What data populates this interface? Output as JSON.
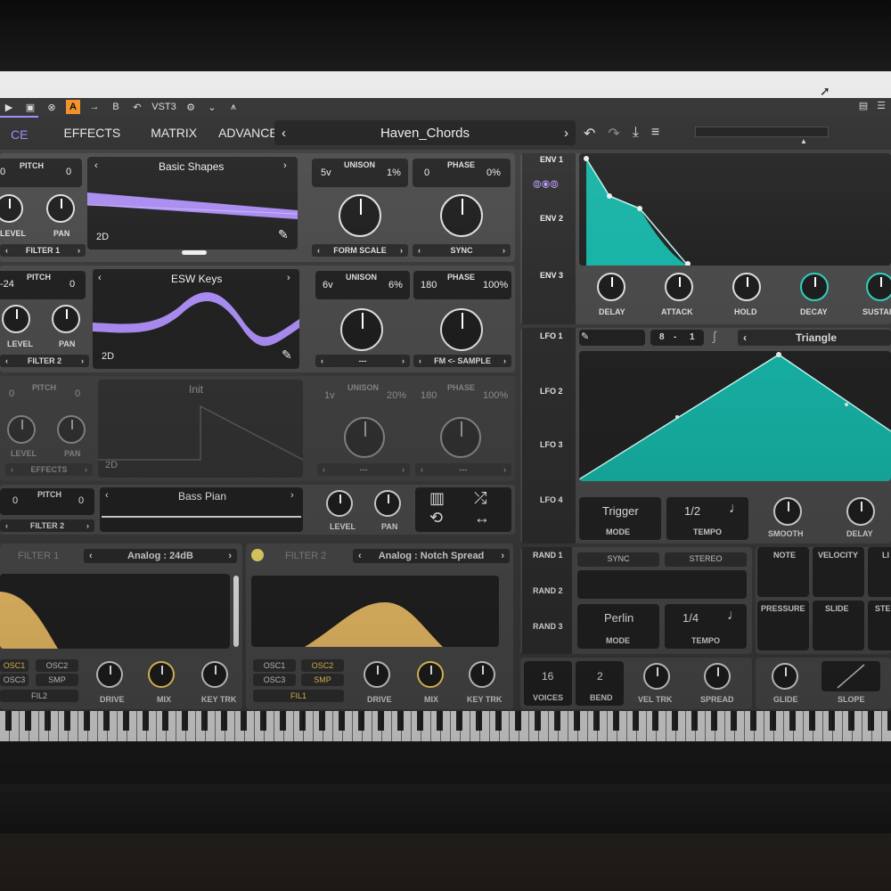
{
  "toolbar": {
    "icons": [
      "play-icon",
      "save-icon",
      "bypass-icon",
      "a-b-compare-icon",
      "arrow-right-icon",
      "b-compare-icon",
      "undo-icon",
      "settings-icon",
      "spectrum-icon"
    ],
    "a_label": "A",
    "b_label": "B",
    "format": "VST3"
  },
  "header": {
    "tabs": [
      {
        "label": "CE",
        "selected": true
      },
      {
        "label": "EFFECTS"
      },
      {
        "label": "MATRIX"
      },
      {
        "label": "ADVANCED"
      }
    ],
    "preset_name": "Haven_Chords",
    "prev_arrow": "‹",
    "next_arrow": "›"
  },
  "osc1": {
    "pitch_label": "PITCH",
    "pitch_left": "0",
    "pitch_right": "0",
    "level_label": "LEVEL",
    "pan_label": "PAN",
    "route": "FILTER 1",
    "wavetable": "Basic Shapes",
    "mode": "2D",
    "unison_label": "UNISON",
    "unison_voices": "5v",
    "unison_detune": "1%",
    "phase_label": "PHASE",
    "phase_value": "0",
    "phase_rand": "0%",
    "form_scale": "FORM SCALE",
    "sync": "SYNC"
  },
  "osc2": {
    "pitch_label": "PITCH",
    "pitch_left": "-24",
    "pitch_right": "0",
    "level_label": "LEVEL",
    "pan_label": "PAN",
    "route": "FILTER 2",
    "wavetable": "ESW Keys",
    "mode": "2D",
    "unison_label": "UNISON",
    "unison_voices": "6v",
    "unison_detune": "6%",
    "phase_label": "PHASE",
    "phase_value": "180",
    "phase_rand": "100%",
    "spectral": "---",
    "fm": "FM <- SAMPLE"
  },
  "osc3": {
    "pitch_label": "PITCH",
    "pitch_left": "0",
    "pitch_right": "0",
    "level_label": "LEVEL",
    "pan_label": "PAN",
    "route": "EFFECTS",
    "wavetable": "Init",
    "mode": "2D",
    "unison_label": "UNISON",
    "unison_voices": "1v",
    "unison_detune": "20%",
    "phase_label": "PHASE",
    "phase_value": "180",
    "phase_rand": "100%",
    "spectral": "---",
    "fm": "---"
  },
  "sample": {
    "pitch_label": "PITCH",
    "pitch_left": "0",
    "pitch_right": "0",
    "route": "FILTER 2",
    "name": "Bass Pian",
    "level_label": "LEVEL",
    "pan_label": "PAN"
  },
  "filter1": {
    "title": "FILTER 1",
    "model": "Analog : 24dB",
    "srcs": [
      "OSC1",
      "OSC2",
      "OSC3",
      "SMP"
    ],
    "route": "FIL2",
    "drive": "DRIVE",
    "mix": "MIX",
    "key_trk": "KEY TRK"
  },
  "filter2": {
    "title": "FILTER 2",
    "model": "Analog : Notch Spread",
    "srcs": [
      "OSC1",
      "OSC2",
      "OSC3",
      "SMP"
    ],
    "route": "FIL1",
    "drive": "DRIVE",
    "mix": "MIX",
    "key_trk": "KEY TRK"
  },
  "env": {
    "tabs": [
      "ENV 1",
      "ENV 2",
      "ENV 3"
    ],
    "knobs": [
      "DELAY",
      "ATTACK",
      "HOLD",
      "DECAY",
      "SUSTAI"
    ]
  },
  "lfo": {
    "tabs": [
      "LFO 1",
      "LFO 2",
      "LFO 3",
      "LFO 4"
    ],
    "grid": "8",
    "grid_sep": "-",
    "smooth_count": "1",
    "shape": "Triangle",
    "mode_value": "Trigger",
    "mode_label": "MODE",
    "tempo_value": "1/2",
    "tempo_label": "TEMPO",
    "smooth_label": "SMOOTH",
    "delay_label": "DELAY"
  },
  "random": {
    "tabs": [
      "RAND 1",
      "RAND 2",
      "RAND 3"
    ],
    "sync": "SYNC",
    "stereo": "STEREO",
    "mode_value": "Perlin",
    "mode_label": "MODE",
    "tempo_value": "1/4",
    "tempo_label": "TEMPO"
  },
  "mod_sources": [
    "NOTE",
    "VELOCITY",
    "LI",
    "PRESSURE",
    "SLIDE",
    "STE"
  ],
  "voice": {
    "voices_value": "16",
    "voices_label": "VOICES",
    "bend_value": "2",
    "bend_label": "BEND",
    "vel_trk": "VEL TRK",
    "spread": "SPREAD",
    "glide": "GLIDE",
    "slope": "SLOPE"
  },
  "colors": {
    "accent_purple": "#9a86ff",
    "wave_purple": "#a98cf0",
    "mod_teal": "#17b3a6",
    "filter_yellow": "#f7c66a"
  }
}
